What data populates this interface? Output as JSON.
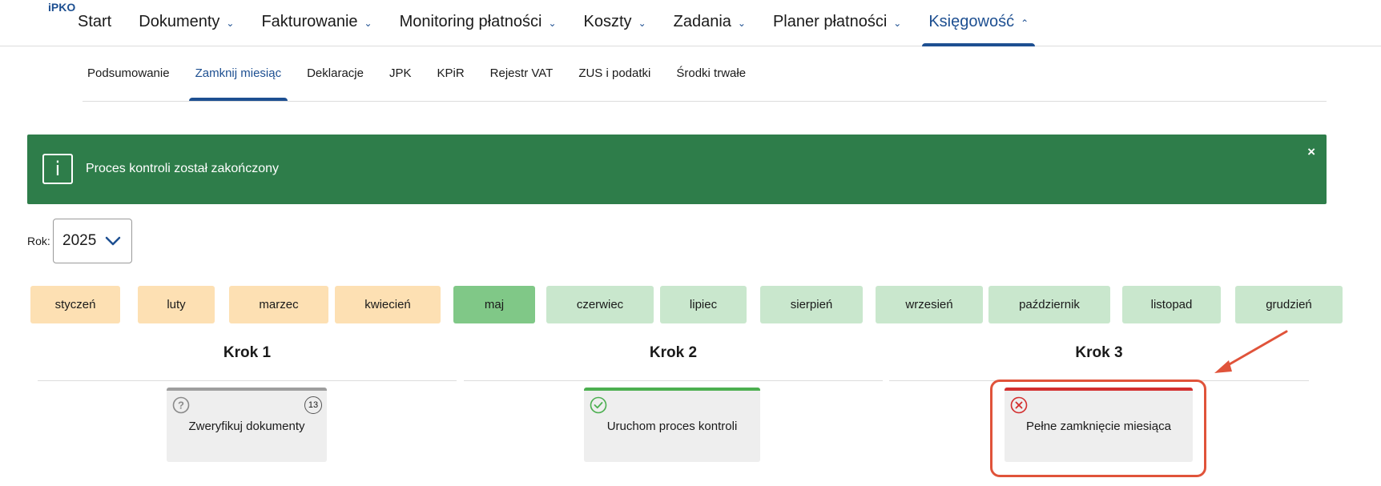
{
  "logo": "iPKO",
  "topnav": {
    "items": [
      {
        "label": "Start",
        "has_chevron": false
      },
      {
        "label": "Dokumenty",
        "has_chevron": true
      },
      {
        "label": "Fakturowanie",
        "has_chevron": true
      },
      {
        "label": "Monitoring płatności",
        "has_chevron": true
      },
      {
        "label": "Koszty",
        "has_chevron": true
      },
      {
        "label": "Zadania",
        "has_chevron": true
      },
      {
        "label": "Planer płatności",
        "has_chevron": true
      },
      {
        "label": "Księgowość",
        "has_chevron": true,
        "active": true
      }
    ]
  },
  "subnav": {
    "items": [
      {
        "label": "Podsumowanie"
      },
      {
        "label": "Zamknij miesiąc",
        "active": true
      },
      {
        "label": "Deklaracje"
      },
      {
        "label": "JPK"
      },
      {
        "label": "KPiR"
      },
      {
        "label": "Rejestr VAT"
      },
      {
        "label": "ZUS i podatki"
      },
      {
        "label": "Środki trwałe"
      }
    ]
  },
  "alert": {
    "icon": "info-icon",
    "text": "Proces kontroli został zakończony",
    "close": "×",
    "color": "#2e7d4a"
  },
  "year": {
    "label": "Rok:",
    "value": "2025"
  },
  "months": [
    {
      "label": "styczeń",
      "status": "past"
    },
    {
      "label": "luty",
      "status": "past"
    },
    {
      "label": "marzec",
      "status": "past"
    },
    {
      "label": "kwiecień",
      "status": "past"
    },
    {
      "label": "maj",
      "status": "current"
    },
    {
      "label": "czerwiec",
      "status": "future"
    },
    {
      "label": "lipiec",
      "status": "future"
    },
    {
      "label": "sierpień",
      "status": "future"
    },
    {
      "label": "wrzesień",
      "status": "future"
    },
    {
      "label": "październik",
      "status": "future"
    },
    {
      "label": "listopad",
      "status": "future"
    },
    {
      "label": "grudzień",
      "status": "future"
    }
  ],
  "steps": [
    {
      "title": "Krok 1",
      "card_label": "Zweryfikuj dokumenty",
      "status": "unknown",
      "icon": "question-icon",
      "count": "13",
      "bar_color": "#9e9e9e"
    },
    {
      "title": "Krok 2",
      "card_label": "Uruchom proces kontroli",
      "status": "done",
      "icon": "check-icon",
      "bar_color": "#4caf50"
    },
    {
      "title": "Krok 3",
      "card_label": "Pełne zamknięcie miesiąca",
      "status": "error",
      "icon": "x-icon",
      "bar_color": "#d32f2f"
    }
  ],
  "colors": {
    "brand": "#1d4f91",
    "past_month": "#fde0b3",
    "current_month": "#80c887",
    "future_month": "#c9e7cd",
    "annotation": "#e0533a"
  }
}
